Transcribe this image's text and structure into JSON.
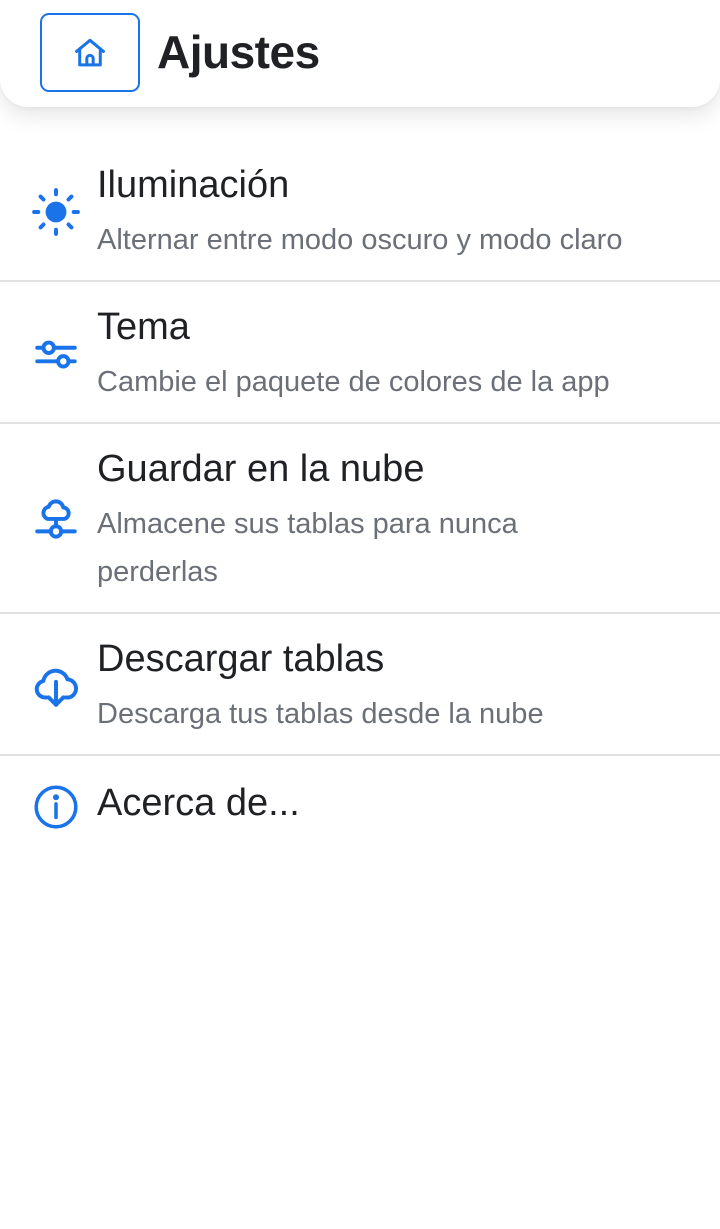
{
  "header": {
    "title": "Ajustes",
    "home_icon": "home-icon"
  },
  "accent_color": "#1a73e8",
  "settings": [
    {
      "title": "Iluminación",
      "description": "Alternar entre modo oscuro y modo claro",
      "icon": "sun-icon"
    },
    {
      "title": "Tema",
      "description": "Cambie el paquete de colores de la app",
      "icon": "sliders-icon"
    },
    {
      "title": "Guardar en la nube",
      "description": "Almacene sus tablas para nunca perderlas",
      "icon": "cloud-network-icon"
    },
    {
      "title": "Descargar tablas",
      "description": "Descarga tus tablas desde la nube",
      "icon": "cloud-download-icon"
    },
    {
      "title": "Acerca de...",
      "icon": "info-icon"
    }
  ]
}
